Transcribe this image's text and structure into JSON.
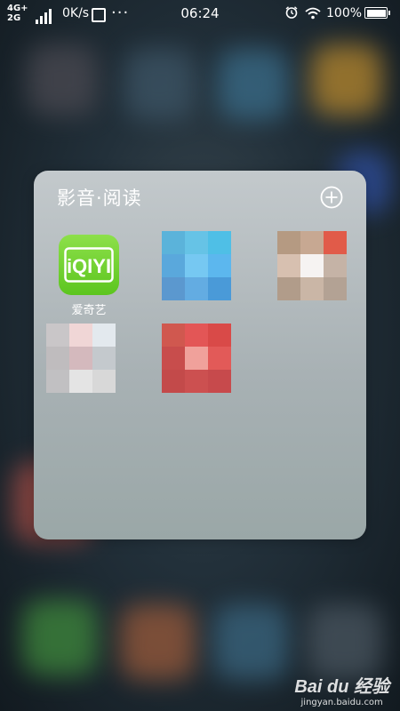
{
  "status_bar": {
    "network_type": "4G+",
    "network_type_2": "2G",
    "net_speed": "0K/s",
    "more_indicator": "···",
    "time": "06:24",
    "battery_percent": "100%"
  },
  "folder": {
    "title": "影音·阅读",
    "apps": [
      {
        "label": "爱奇艺",
        "icon": "iqiyi-logo",
        "icon_text": "iQIYI",
        "color": "#6ccf2a"
      }
    ]
  },
  "watermark": {
    "logo": "Bai du 经验",
    "url": "jingyan.baidu.com"
  }
}
